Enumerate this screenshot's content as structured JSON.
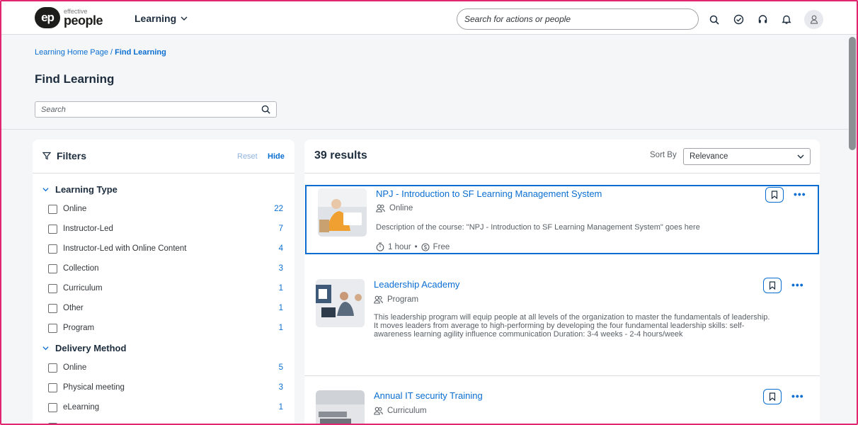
{
  "brand": {
    "small": "effective",
    "big": "people",
    "badge": "ep"
  },
  "nav": {
    "label": "Learning"
  },
  "shell_search": {
    "placeholder": "Search for actions or people"
  },
  "breadcrumb": {
    "root": "Learning Home Page",
    "separator": " / ",
    "current": "Find Learning"
  },
  "page": {
    "title": "Find Learning",
    "search_placeholder": "Search"
  },
  "filters": {
    "title": "Filters",
    "reset": "Reset",
    "hide": "Hide",
    "groups": [
      {
        "title": "Learning Type",
        "options": [
          {
            "label": "Online",
            "count": "22"
          },
          {
            "label": "Instructor-Led",
            "count": "7"
          },
          {
            "label": "Instructor-Led with Online Content",
            "count": "4"
          },
          {
            "label": "Collection",
            "count": "3"
          },
          {
            "label": "Curriculum",
            "count": "1"
          },
          {
            "label": "Other",
            "count": "1"
          },
          {
            "label": "Program",
            "count": "1"
          }
        ]
      },
      {
        "title": "Delivery Method",
        "options": [
          {
            "label": "Online",
            "count": "5"
          },
          {
            "label": "Physical meeting",
            "count": "3"
          },
          {
            "label": "eLearning",
            "count": "1"
          }
        ]
      }
    ]
  },
  "results": {
    "count": "39 results",
    "sort_label": "Sort By",
    "sort_value": "Relevance",
    "items": [
      {
        "title": "NPJ - Introduction to SF Learning Management System",
        "type": "Online",
        "description": "Description of the course: \"NPJ - Introduction to SF Learning Management System\" goes here",
        "duration": "1 hour",
        "separator": "•",
        "price": "Free"
      },
      {
        "title": "Leadership Academy",
        "type": "Program",
        "description": "This leadership program will equip people at all levels of the organization to master the fundamentals of leadership. It moves leaders from average to high-performing by developing the four fundamental leadership skills: self-awareness learning agility influence communication Duration: 3-4 weeks - 2-4 hours/week"
      },
      {
        "title": "Annual IT security Training",
        "type": "Curriculum"
      }
    ]
  },
  "colors": {
    "accent": "#0a6ed1",
    "frame": "#e0266f",
    "selected_border": "#0a6ed1"
  },
  "icons": [
    "search-icon",
    "check-circle-icon",
    "headset-icon",
    "bell-icon",
    "user-icon",
    "filter-icon",
    "chevron-down-icon",
    "bookmark-icon",
    "more-icon",
    "people-icon",
    "timer-icon",
    "price-icon"
  ]
}
